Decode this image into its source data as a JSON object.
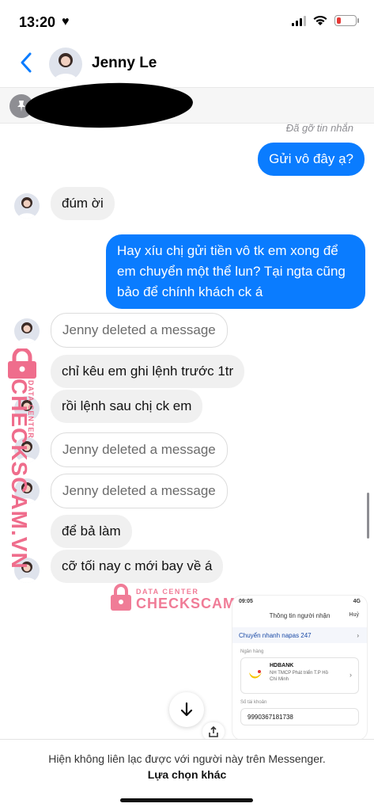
{
  "status_bar": {
    "time": "13:20",
    "heart": "♥"
  },
  "header": {
    "contact_name": "Jenny Le",
    "back_icon": "chevron-left-icon"
  },
  "pinned": {
    "icon": "pin-icon"
  },
  "unsent_notice": "Đã gỡ tin nhắn",
  "messages": [
    {
      "direction": "out",
      "text": "Gửi vô đây ạ?"
    },
    {
      "direction": "in",
      "text": "đúm ời"
    },
    {
      "direction": "out",
      "text": "Hay xíu chị gửi tiền vô tk em xong để em chuyển một thể lun? Tại ngta cũng bảo để chính khách ck á"
    },
    {
      "direction": "in",
      "type": "deleted",
      "text": "Jenny deleted a message"
    },
    {
      "direction": "in",
      "text": "chỉ kêu em ghi lệnh trước 1tr"
    },
    {
      "direction": "in",
      "text": "rồi lệnh sau chị ck em"
    },
    {
      "direction": "in",
      "type": "deleted",
      "text": "Jenny deleted a message"
    },
    {
      "direction": "in",
      "type": "deleted",
      "text": "Jenny deleted a message"
    },
    {
      "direction": "in",
      "text": "để bả làm"
    },
    {
      "direction": "in",
      "text": "cỡ tối nay c mới bay về á"
    }
  ],
  "watermark": {
    "brand": "CHECKSCAM.VN",
    "sub": "DATA CENTER"
  },
  "attachment": {
    "time": "09:05",
    "network": "4G",
    "title": "Thông tin người nhận",
    "cancel": "Huỷ",
    "transfer_type": "Chuyển nhanh napas 247",
    "bank_label": "Ngân hàng",
    "bank_name": "HDBANK",
    "bank_full": "NH TMCP Phát triển T.P Hồ Chí Minh",
    "account_label": "Số tài khoản",
    "account_number": "9990367181738"
  },
  "footer": {
    "notice": "Hiện không liên lạc được với người này trên Messenger.",
    "link": "Lựa chọn khác"
  },
  "colors": {
    "outgoing": "#0a7cff",
    "incoming": "#f0f0f0",
    "watermark": "#f07c97"
  }
}
